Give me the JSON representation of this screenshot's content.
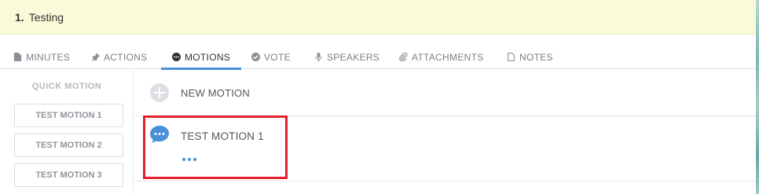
{
  "agenda": {
    "number": "1.",
    "title": "Testing"
  },
  "tabs": [
    {
      "label": "MINUTES",
      "icon": "document-icon"
    },
    {
      "label": "ACTIONS",
      "icon": "pin-icon"
    },
    {
      "label": "MOTIONS",
      "icon": "chat-bubble-icon",
      "active": true
    },
    {
      "label": "VOTE",
      "icon": "check-circle-icon"
    },
    {
      "label": "SPEAKERS",
      "icon": "microphone-icon"
    },
    {
      "label": "ATTACHMENTS",
      "icon": "paperclip-icon"
    },
    {
      "label": "NOTES",
      "icon": "note-icon"
    }
  ],
  "quick_motion": {
    "title": "QUICK MOTION",
    "buttons": [
      "TEST MOTION 1",
      "TEST MOTION 2",
      "TEST MOTION 3"
    ]
  },
  "new_motion": {
    "label": "NEW MOTION"
  },
  "motions": [
    {
      "title": "TEST MOTION 1"
    }
  ],
  "colors": {
    "accent": "#4a90d9",
    "highlight": "#e3202b",
    "header_bg": "#fafad8"
  }
}
